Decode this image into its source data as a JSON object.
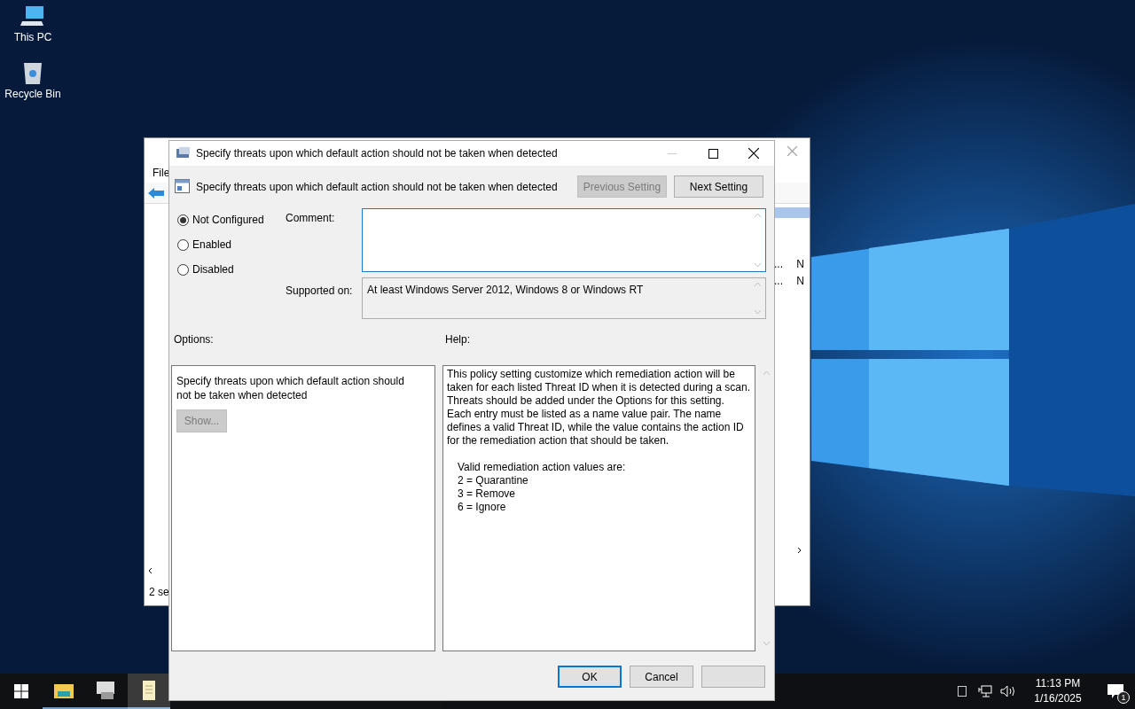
{
  "desktop_icons": [
    {
      "label": "This PC",
      "kind": "computer"
    },
    {
      "label": "Recycle Bin",
      "kind": "bin"
    }
  ],
  "background_window": {
    "menu": [
      "File"
    ],
    "rows": [
      {
        "column_1": "...",
        "column_2": "N"
      },
      {
        "column_1": "...",
        "column_2": "N"
      }
    ],
    "status": "2 se"
  },
  "dialog": {
    "title": "Specify threats upon which default action should not be taken when detected",
    "header_title": "Specify threats upon which default action should not be taken when detected",
    "nav_buttons": [
      {
        "label": "Previous Setting",
        "disabled": true
      },
      {
        "label": "Next Setting",
        "disabled": false
      }
    ],
    "states": [
      {
        "label": "Not Configured",
        "selected": true
      },
      {
        "label": "Enabled",
        "selected": false
      },
      {
        "label": "Disabled",
        "selected": false
      }
    ],
    "comment_label": "Comment:",
    "supported_label": "Supported on:",
    "supported_value": "At least Windows Server 2012, Windows 8 or Windows RT",
    "options_label": "Options:",
    "help_label": "Help:",
    "options_text": "Specify threats upon which default action should not be taken when detected",
    "show_button": {
      "label": "Show...",
      "disabled": true
    },
    "help_paragraph": "This policy setting customize which remediation action will be taken for each listed Threat ID when it is detected during a scan. Threats should be added under the Options for this setting. Each entry must be listed as a name value pair. The name defines a valid Threat ID, while the value contains the action ID for the remediation action that should be taken.",
    "help_lines": [
      "Valid remediation action values are:",
      "2 = Quarantine",
      "3 = Remove",
      "6 = Ignore"
    ],
    "buttons": [
      {
        "label": "OK",
        "selected": true
      },
      {
        "label": "Cancel",
        "selected": false
      }
    ]
  },
  "taskbar": {
    "apps": [
      {
        "kind": "explorer",
        "selected": false
      },
      {
        "kind": "server",
        "selected": false
      },
      {
        "kind": "policy",
        "selected": true
      }
    ],
    "time": "11:13 PM",
    "date": "1/16/2025",
    "notifications": "1"
  }
}
